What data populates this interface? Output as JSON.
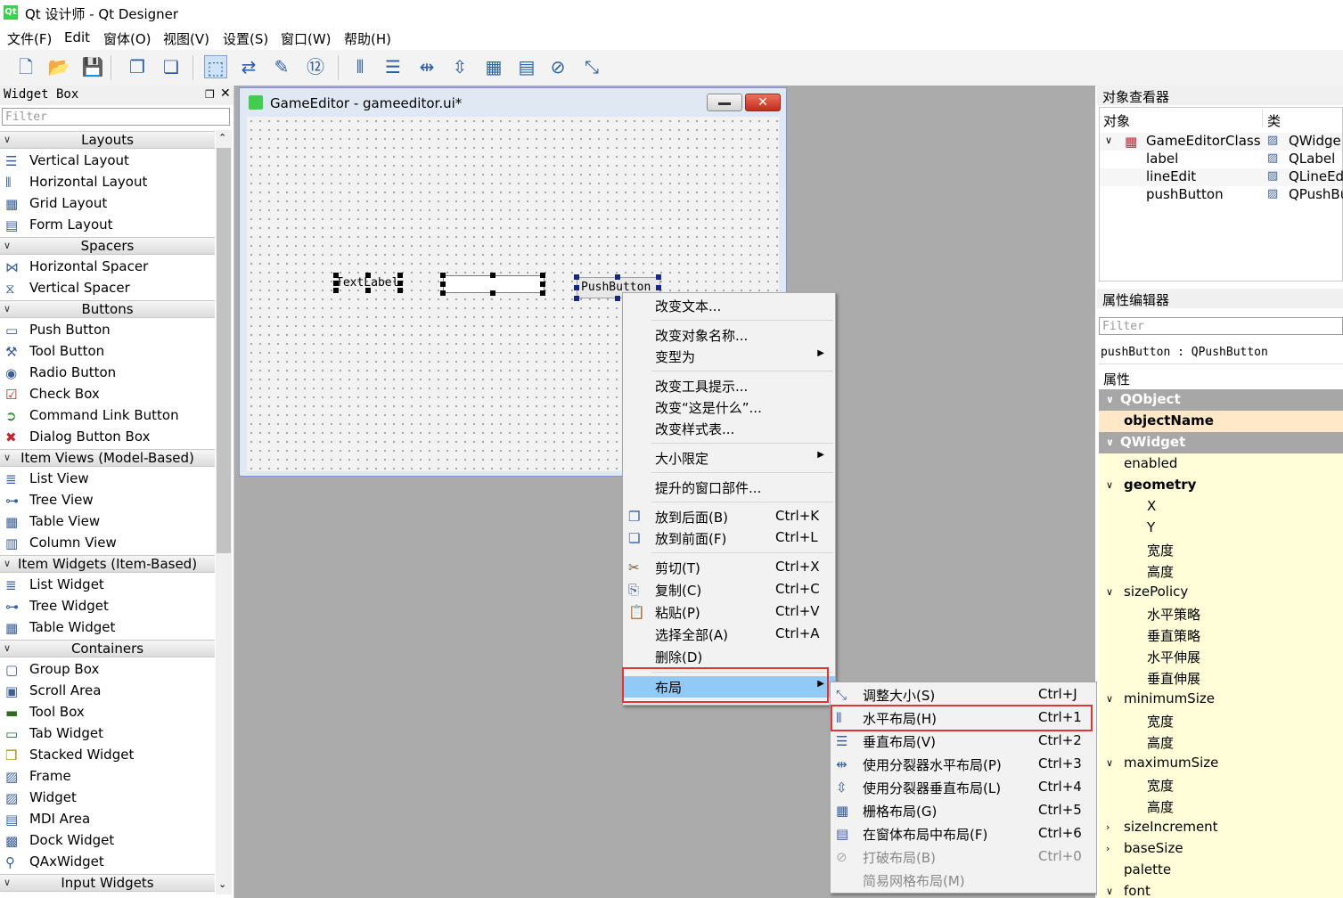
{
  "window": {
    "title": "Qt 设计师 - Qt Designer",
    "logo": "Qt"
  },
  "menubar": [
    "文件(F)",
    "Edit",
    "窗体(O)",
    "视图(V)",
    "设置(S)",
    "窗口(W)",
    "帮助(H)"
  ],
  "toolbar_icons": [
    "new-file-icon",
    "open-file-icon",
    "save-icon",
    "send-to-back-icon",
    "bring-to-front-icon",
    "edit-widgets-icon",
    "edit-signals-icon",
    "edit-buddies-icon",
    "edit-tab-order-icon",
    "horizontal-layout-icon",
    "vertical-layout-icon",
    "horizontal-splitter-icon",
    "vertical-splitter-icon",
    "grid-layout-icon",
    "form-layout-icon",
    "break-layout-icon",
    "adjust-size-icon"
  ],
  "widget_box": {
    "title": "Widget Box",
    "filter_placeholder": "Filter",
    "rows": [
      {
        "kind": "cat",
        "label": "Layouts"
      },
      {
        "kind": "item",
        "label": "Vertical Layout",
        "icon": "vertical-layout-icon"
      },
      {
        "kind": "item",
        "label": "Horizontal Layout",
        "icon": "horizontal-layout-icon"
      },
      {
        "kind": "item",
        "label": "Grid Layout",
        "icon": "grid-layout-icon"
      },
      {
        "kind": "item",
        "label": "Form Layout",
        "icon": "form-layout-icon"
      },
      {
        "kind": "cat",
        "label": "Spacers"
      },
      {
        "kind": "item",
        "label": "Horizontal Spacer",
        "icon": "horizontal-spacer-icon"
      },
      {
        "kind": "item",
        "label": "Vertical Spacer",
        "icon": "vertical-spacer-icon"
      },
      {
        "kind": "cat",
        "label": "Buttons"
      },
      {
        "kind": "item",
        "label": "Push Button",
        "icon": "push-button-icon"
      },
      {
        "kind": "item",
        "label": "Tool Button",
        "icon": "tool-button-icon"
      },
      {
        "kind": "item",
        "label": "Radio Button",
        "icon": "radio-button-icon"
      },
      {
        "kind": "item",
        "label": "Check Box",
        "icon": "check-box-icon"
      },
      {
        "kind": "item",
        "label": "Command Link Button",
        "icon": "command-link-icon"
      },
      {
        "kind": "item",
        "label": "Dialog Button Box",
        "icon": "dialog-button-box-icon"
      },
      {
        "kind": "cat",
        "label": "Item Views (Model-Based)"
      },
      {
        "kind": "item",
        "label": "List View",
        "icon": "list-view-icon"
      },
      {
        "kind": "item",
        "label": "Tree View",
        "icon": "tree-view-icon"
      },
      {
        "kind": "item",
        "label": "Table View",
        "icon": "table-view-icon"
      },
      {
        "kind": "item",
        "label": "Column View",
        "icon": "column-view-icon"
      },
      {
        "kind": "cat",
        "label": "Item Widgets (Item-Based)"
      },
      {
        "kind": "item",
        "label": "List Widget",
        "icon": "list-widget-icon"
      },
      {
        "kind": "item",
        "label": "Tree Widget",
        "icon": "tree-widget-icon"
      },
      {
        "kind": "item",
        "label": "Table Widget",
        "icon": "table-widget-icon"
      },
      {
        "kind": "cat",
        "label": "Containers"
      },
      {
        "kind": "item",
        "label": "Group Box",
        "icon": "group-box-icon"
      },
      {
        "kind": "item",
        "label": "Scroll Area",
        "icon": "scroll-area-icon"
      },
      {
        "kind": "item",
        "label": "Tool Box",
        "icon": "tool-box-icon"
      },
      {
        "kind": "item",
        "label": "Tab Widget",
        "icon": "tab-widget-icon"
      },
      {
        "kind": "item",
        "label": "Stacked Widget",
        "icon": "stacked-widget-icon"
      },
      {
        "kind": "item",
        "label": "Frame",
        "icon": "frame-icon"
      },
      {
        "kind": "item",
        "label": "Widget",
        "icon": "widget-icon"
      },
      {
        "kind": "item",
        "label": "MDI Area",
        "icon": "mdi-area-icon"
      },
      {
        "kind": "item",
        "label": "Dock Widget",
        "icon": "dock-widget-icon"
      },
      {
        "kind": "item",
        "label": "QAxWidget",
        "icon": "qaxwidget-icon"
      },
      {
        "kind": "cat",
        "label": "Input Widgets"
      }
    ]
  },
  "form": {
    "title": "GameEditor - gameeditor.ui*",
    "label_text": "TextLabel",
    "button_text": "PushButton"
  },
  "context_menu": {
    "items": [
      {
        "label": "改变文本...",
        "shortcut": "",
        "submenu": false
      },
      {
        "sep": true
      },
      {
        "label": "改变对象名称...",
        "shortcut": "",
        "submenu": false
      },
      {
        "label": "变型为",
        "shortcut": "",
        "submenu": true
      },
      {
        "sep": true
      },
      {
        "label": "改变工具提示...",
        "shortcut": "",
        "submenu": false
      },
      {
        "label": "改变“这是什么”...",
        "shortcut": "",
        "submenu": false
      },
      {
        "label": "改变样式表...",
        "shortcut": "",
        "submenu": false
      },
      {
        "sep": true
      },
      {
        "label": "大小限定",
        "shortcut": "",
        "submenu": true
      },
      {
        "sep": true
      },
      {
        "label": "提升的窗口部件...",
        "shortcut": "",
        "submenu": false
      },
      {
        "sep": true
      },
      {
        "label": "放到后面(B)",
        "shortcut": "Ctrl+K",
        "submenu": false,
        "icon": "send-to-back-icon"
      },
      {
        "label": "放到前面(F)",
        "shortcut": "Ctrl+L",
        "submenu": false,
        "icon": "bring-to-front-icon"
      },
      {
        "sep": true
      },
      {
        "label": "剪切(T)",
        "shortcut": "Ctrl+X",
        "submenu": false,
        "icon": "cut-icon"
      },
      {
        "label": "复制(C)",
        "shortcut": "Ctrl+C",
        "submenu": false,
        "icon": "copy-icon"
      },
      {
        "label": "粘贴(P)",
        "shortcut": "Ctrl+V",
        "submenu": false,
        "icon": "paste-icon"
      },
      {
        "label": "选择全部(A)",
        "shortcut": "Ctrl+A",
        "submenu": false
      },
      {
        "label": "删除(D)",
        "shortcut": "",
        "submenu": false
      },
      {
        "sep": true
      },
      {
        "label": "布局",
        "shortcut": "",
        "submenu": true,
        "highlight": true
      }
    ]
  },
  "layout_submenu": {
    "items": [
      {
        "label": "调整大小(S)",
        "shortcut": "Ctrl+J",
        "icon": "adjust-size-icon"
      },
      {
        "label": "水平布局(H)",
        "shortcut": "Ctrl+1",
        "icon": "horizontal-layout-icon",
        "highlight": true
      },
      {
        "label": "垂直布局(V)",
        "shortcut": "Ctrl+2",
        "icon": "vertical-layout-icon"
      },
      {
        "label": "使用分裂器水平布局(P)",
        "shortcut": "Ctrl+3",
        "icon": "horizontal-splitter-icon"
      },
      {
        "label": "使用分裂器垂直布局(L)",
        "shortcut": "Ctrl+4",
        "icon": "vertical-splitter-icon"
      },
      {
        "label": "栅格布局(G)",
        "shortcut": "Ctrl+5",
        "icon": "grid-layout-icon"
      },
      {
        "label": "在窗体布局中布局(F)",
        "shortcut": "Ctrl+6",
        "icon": "form-layout-icon"
      },
      {
        "label": "打破布局(B)",
        "shortcut": "Ctrl+0",
        "icon": "break-layout-icon",
        "disabled": true
      },
      {
        "label": "简易网格布局(M)",
        "shortcut": "",
        "disabled": true
      }
    ]
  },
  "object_inspector": {
    "title": "对象查看器",
    "col_object": "对象",
    "col_class": "类",
    "rows": [
      {
        "name": "GameEditorClass",
        "cls": "QWidge",
        "level": 0
      },
      {
        "name": "label",
        "cls": "QLabel",
        "level": 1
      },
      {
        "name": "lineEdit",
        "cls": "QLineEd",
        "level": 1
      },
      {
        "name": "pushButton",
        "cls": "QPushBu",
        "level": 1
      }
    ]
  },
  "property_editor": {
    "title": "属性编辑器",
    "filter_placeholder": "Filter",
    "object_line": "pushButton : QPushButton",
    "col_property": "属性",
    "rows": [
      {
        "label": "QObject",
        "kind": "group"
      },
      {
        "label": "objectName",
        "kind": "bold",
        "indent": 1
      },
      {
        "label": "QWidget",
        "kind": "group"
      },
      {
        "label": "enabled",
        "indent": 1
      },
      {
        "label": "geometry",
        "kind": "bold",
        "indent": 1,
        "expand": true
      },
      {
        "label": "X",
        "indent": 2
      },
      {
        "label": "Y",
        "indent": 2
      },
      {
        "label": "宽度",
        "indent": 2
      },
      {
        "label": "高度",
        "indent": 2
      },
      {
        "label": "sizePolicy",
        "indent": 1,
        "expand": true
      },
      {
        "label": "水平策略",
        "indent": 2
      },
      {
        "label": "垂直策略",
        "indent": 2
      },
      {
        "label": "水平伸展",
        "indent": 2
      },
      {
        "label": "垂直伸展",
        "indent": 2
      },
      {
        "label": "minimumSize",
        "indent": 1,
        "expand": true
      },
      {
        "label": "宽度",
        "indent": 2
      },
      {
        "label": "高度",
        "indent": 2
      },
      {
        "label": "maximumSize",
        "indent": 1,
        "expand": true
      },
      {
        "label": "宽度",
        "indent": 2
      },
      {
        "label": "高度",
        "indent": 2
      },
      {
        "label": "sizeIncrement",
        "indent": 1,
        "collapsed": true
      },
      {
        "label": "baseSize",
        "indent": 1,
        "collapsed": true
      },
      {
        "label": "palette",
        "indent": 1
      },
      {
        "label": "font",
        "indent": 1,
        "expand": true
      }
    ]
  }
}
